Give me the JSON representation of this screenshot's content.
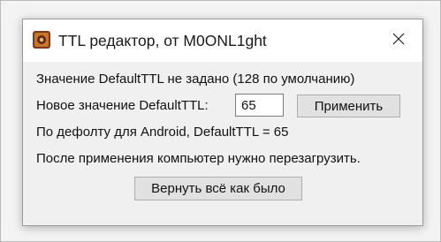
{
  "window": {
    "title": "TTL редактор, от M0ONL1ght",
    "icon": "app-icon",
    "close_icon": "close-icon"
  },
  "content": {
    "status_text": "Значение DefaultTTL не задано (128 по умолчанию)",
    "new_value_label": "Новое значение DefaultTTL:",
    "new_value_input": "65",
    "apply_button_label": "Применить",
    "android_hint": "По дефолту для Android, DefaultTTL = 65",
    "restart_note": "После применения компьютер нужно перезагрузить.",
    "revert_button_label": "Вернуть всё как было"
  }
}
